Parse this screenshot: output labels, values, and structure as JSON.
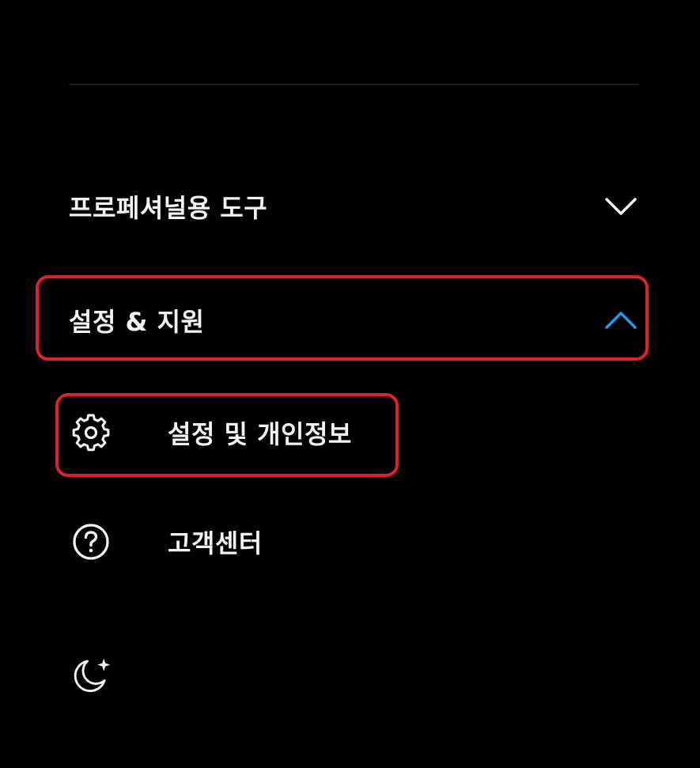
{
  "menu": {
    "sections": [
      {
        "label": "프로페셔널용 도구",
        "expanded": false,
        "chevron": "chevron-down-icon"
      },
      {
        "label": "설정 & 지원",
        "expanded": true,
        "chevron": "chevron-up-icon"
      }
    ],
    "settings_items": [
      {
        "label": "설정 및 개인정보",
        "icon": "gear-icon"
      },
      {
        "label": "고객센터",
        "icon": "question-circle-icon"
      }
    ],
    "theme_toggle": {
      "icon": "moon-sparkle-icon"
    }
  },
  "colors": {
    "background": "#000000",
    "text": "#f2f2f2",
    "accent": "#1d9bf0",
    "highlight": "#e0202e",
    "divider": "#2c2c2c"
  }
}
